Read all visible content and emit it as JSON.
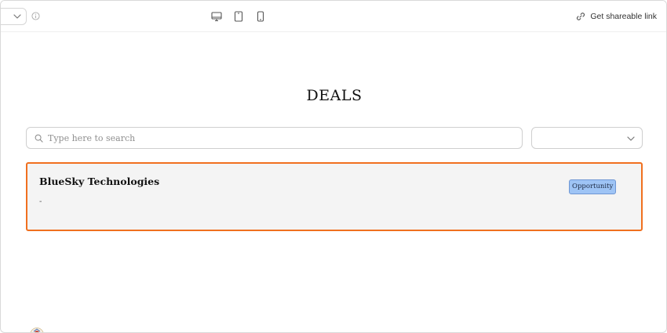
{
  "toolbar": {
    "share_label": "Get shareable link",
    "devices": [
      "desktop-icon",
      "tablet-icon",
      "mobile-icon"
    ]
  },
  "page": {
    "title": "DEALS"
  },
  "search": {
    "placeholder": "Type here to search",
    "value": ""
  },
  "filter": {
    "selected": ""
  },
  "deals": [
    {
      "name": "BlueSky Technologies",
      "subtitle": "-",
      "stage": "Opportunity"
    }
  ],
  "colors": {
    "accent": "#f0701f",
    "badge_bg": "#9ec4f5",
    "badge_border": "#6f97d4",
    "card_bg": "#f4f4f4"
  }
}
